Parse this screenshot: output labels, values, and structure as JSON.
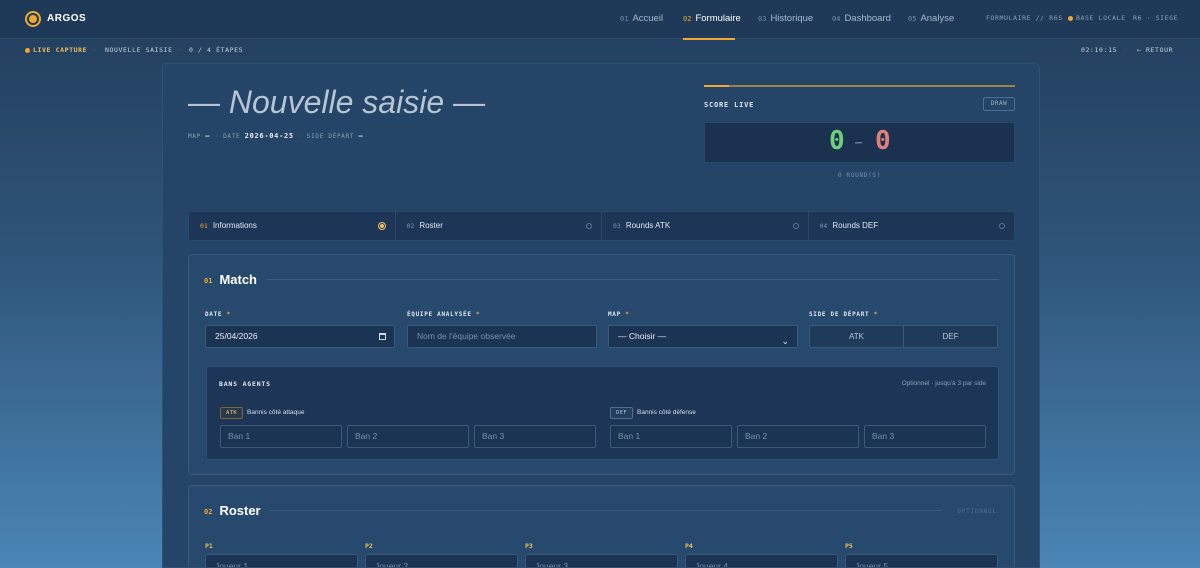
{
  "app": {
    "name": "ARGOS"
  },
  "nav": [
    {
      "num": "01",
      "label": "Accueil"
    },
    {
      "num": "02",
      "label": "Formulaire"
    },
    {
      "num": "03",
      "label": "Historique"
    },
    {
      "num": "04",
      "label": "Dashboard"
    },
    {
      "num": "05",
      "label": "Analyse"
    }
  ],
  "topright": {
    "form": "FORMULAIRE // R6S",
    "base": "BASE LOCALE",
    "siege": "R6 · SIEGE"
  },
  "subbar": {
    "live": "LIVE CAPTURE",
    "mode": "NOUVELLE SAISIE",
    "progress": "0 / 4 ÉTAPES",
    "time": "02:10:15",
    "back": "← RETOUR"
  },
  "page": {
    "title": "— Nouvelle saisie —",
    "meta": {
      "map_label": "MAP",
      "map_value": "—",
      "date_label": "DATE",
      "date_value": "2026-04-25",
      "side_label": "SIDE DÉPART",
      "side_value": "—"
    }
  },
  "score": {
    "label": "SCORE LIVE",
    "draw": "DRAW",
    "left": "0",
    "dash": "—",
    "right": "0",
    "rounds": "0 ROUND(S)",
    "accent": "#f0a830",
    "left_color": "#6fcf7a",
    "right_color": "#e07d7d"
  },
  "steps": [
    {
      "num": "01",
      "label": "Informations"
    },
    {
      "num": "02",
      "label": "Roster"
    },
    {
      "num": "03",
      "label": "Rounds ATK"
    },
    {
      "num": "04",
      "label": "Rounds DEF"
    }
  ],
  "match": {
    "num": "01",
    "title": "Match",
    "date_label": "DATE",
    "date_value": "25/04/2026",
    "team_label": "ÉQUIPE ANALYSÉE",
    "team_placeholder": "Nom de l'équipe observée",
    "map_label": "MAP",
    "map_value": "— Choisir —",
    "side_label": "SIDE DE DÉPART",
    "side_options": [
      "ATK",
      "DEF"
    ],
    "required": "*"
  },
  "bans": {
    "title": "BANS AGENTS",
    "hint": "Optionnel · jusqu'à 3 par side",
    "atk_tag": "ATK",
    "atk_label": "Bannis côté attaque",
    "def_tag": "DEF",
    "def_label": "Bannis côté défense",
    "atk": [
      "Ban 1",
      "Ban 2",
      "Ban 3"
    ],
    "def": [
      "Ban 1",
      "Ban 2",
      "Ban 3"
    ]
  },
  "roster": {
    "num": "02",
    "title": "Roster",
    "optional": "OPTIONNEL",
    "players": [
      {
        "label": "P1",
        "placeholder": "Joueur 1"
      },
      {
        "label": "P2",
        "placeholder": "Joueur 2"
      },
      {
        "label": "P3",
        "placeholder": "Joueur 3"
      },
      {
        "label": "P4",
        "placeholder": "Joueur 4"
      },
      {
        "label": "P5",
        "placeholder": "Joueur 5"
      }
    ]
  }
}
